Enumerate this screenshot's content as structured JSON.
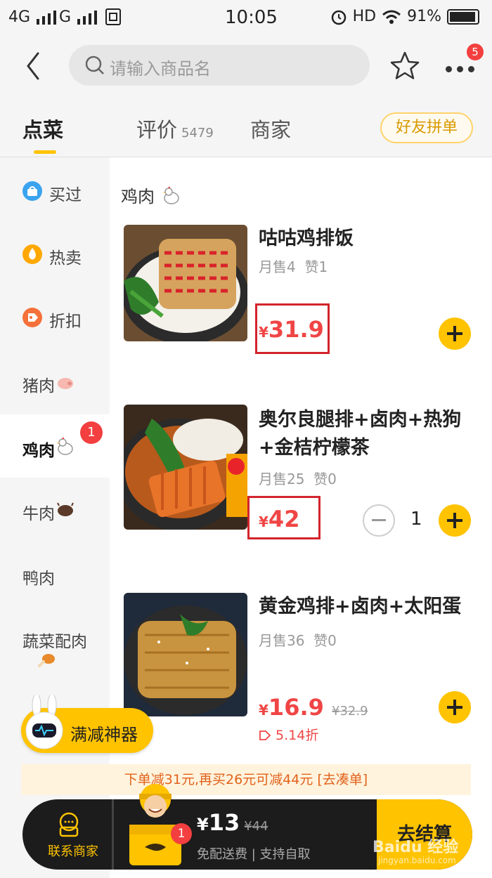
{
  "status_bar": {
    "signal_left": "4G",
    "signal_right": "G",
    "time": "10:05",
    "network": "HD",
    "battery": "91%"
  },
  "header": {
    "search_placeholder": "请输入商品名",
    "more_badge": "5"
  },
  "tabs": [
    {
      "label": "点菜"
    },
    {
      "label": "评价",
      "count": "5479"
    },
    {
      "label": "商家"
    }
  ],
  "group_order_label": "好友拼单",
  "sidebar": {
    "items": [
      {
        "label": "买过",
        "icon": "basket-icon"
      },
      {
        "label": "热卖",
        "icon": "flame-icon"
      },
      {
        "label": "折扣",
        "icon": "discount-tag-icon"
      },
      {
        "label": "猪肉",
        "icon": "pig-emoji-icon"
      },
      {
        "label": "鸡肉",
        "icon": "chicken-emoji-icon",
        "badge": "1"
      },
      {
        "label": "牛肉",
        "icon": "cow-emoji-icon"
      },
      {
        "label": "鸭肉"
      },
      {
        "label": "蔬菜配肉",
        "icon": "drumstick-emoji-icon"
      }
    ]
  },
  "category_title": "鸡肉",
  "products": [
    {
      "name": "咕咕鸡排饭",
      "sales": "月售4",
      "likes": "赞1",
      "yen": "¥",
      "price": "31.9"
    },
    {
      "name": "奥尔良腿排+卤肉+热狗+金桔柠檬茶",
      "sales": "月售25",
      "likes": "赞0",
      "yen": "¥",
      "price": "42",
      "qty": "1"
    },
    {
      "name": "黄金鸡排+卤肉+太阳蛋",
      "sales": "月售36",
      "likes": "赞0",
      "yen": "¥",
      "price": "16.9",
      "original_price": "¥32.9",
      "discount": "5.14折"
    }
  ],
  "promo": {
    "pill_label": "满减神器",
    "banner": "下单减31元,再买26元可减44元 [去凑单]"
  },
  "cart": {
    "contact_label": "联系商家",
    "badge": "1",
    "yen": "¥",
    "total": "13",
    "original_total": "¥44",
    "delivery_info": "免配送费 | 支持自取",
    "checkout_label": "去结算"
  },
  "watermark": {
    "brand": "Baidu 经验",
    "url": "jingyan.baidu.com"
  },
  "colors": {
    "accent": "#ffc300",
    "price": "#f04545",
    "highlight_box": "#d3242b"
  }
}
